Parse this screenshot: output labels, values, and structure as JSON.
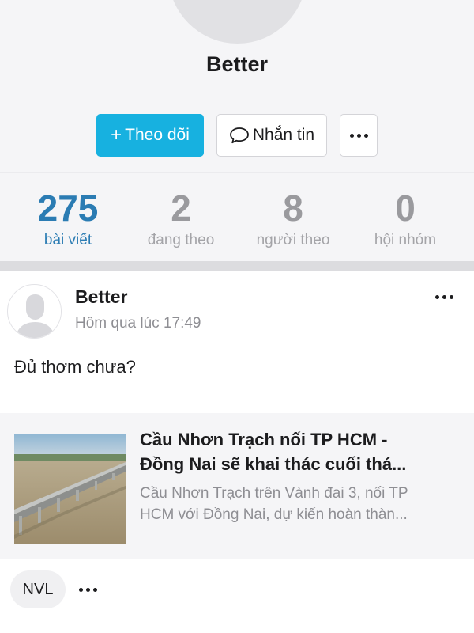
{
  "profile": {
    "name": "Better",
    "follow_label": "Theo dõi",
    "follow_icon": "plus-icon",
    "message_label": "Nhắn tin",
    "message_icon": "chat-bubble-icon",
    "more_icon": "more-dots-icon"
  },
  "stats": [
    {
      "value": "275",
      "label": "bài viết",
      "active": true
    },
    {
      "value": "2",
      "label": "đang theo",
      "active": false
    },
    {
      "value": "8",
      "label": "người theo",
      "active": false
    },
    {
      "value": "0",
      "label": "hội nhóm",
      "active": false
    }
  ],
  "post": {
    "author": "Better",
    "time": "Hôm qua lúc 17:49",
    "content": "Đủ thơm chưa?",
    "link": {
      "title": "Cầu Nhơn Trạch nối TP HCM -\nĐồng Nai sẽ khai thác cuối thá...",
      "description": "Cầu Nhơn Trạch trên Vành đai 3, nối TP\nHCM với Đồng Nai, dự kiến hoàn thàn..."
    },
    "tag": "NVL"
  },
  "colors": {
    "accent": "#17b1e0",
    "active_stat": "#2b7cb3",
    "muted": "#8e8e93",
    "header_bg": "#f5f5f7"
  }
}
